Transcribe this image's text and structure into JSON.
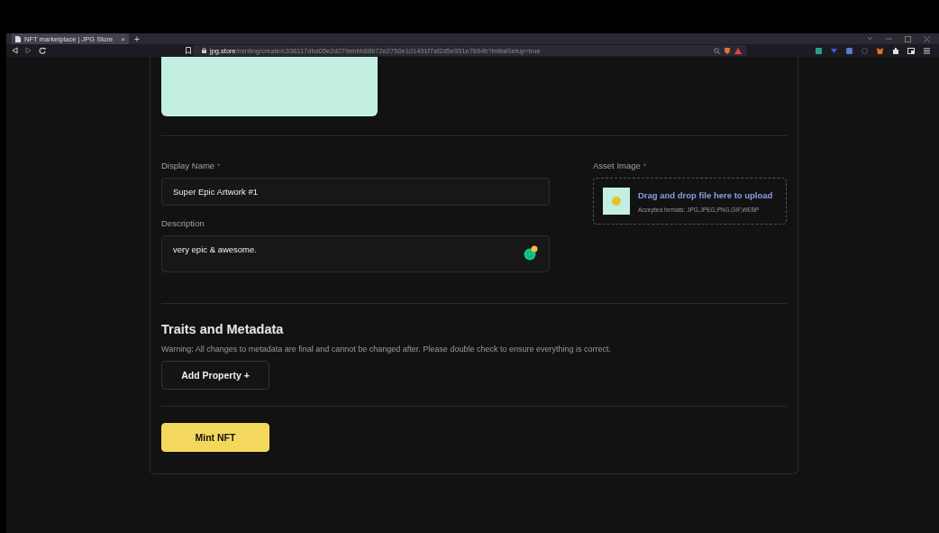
{
  "browser": {
    "tab": {
      "title": "NFT marketplace | JPG Store",
      "close": "×",
      "new_tab": "+"
    },
    "url": "**jpg.store**/minting/create/c336117dbd05e2d279ebbb88b72e2750e101491f7af2d5e931e7694b?initialSetup=true"
  },
  "form": {
    "display_name": {
      "label": "Display Name",
      "required_mark": "*",
      "value": "Super Epic Artwork #1"
    },
    "description": {
      "label": "Description",
      "value": "very epic & awesome."
    },
    "asset_image": {
      "label": "Asset Image",
      "required_mark": "*",
      "prompt": "Drag and drop file here to upload",
      "formats": "Accepted formats: JPG,JPEG,PNG,GIF,WEBP"
    }
  },
  "traits": {
    "heading": "Traits and Metadata",
    "warning": "Warning: All changes to metadata are final and cannot be changed after. Please double check to ensure everything is correct.",
    "add_button": "Add Property +"
  },
  "mint_button": "Mint NFT"
}
